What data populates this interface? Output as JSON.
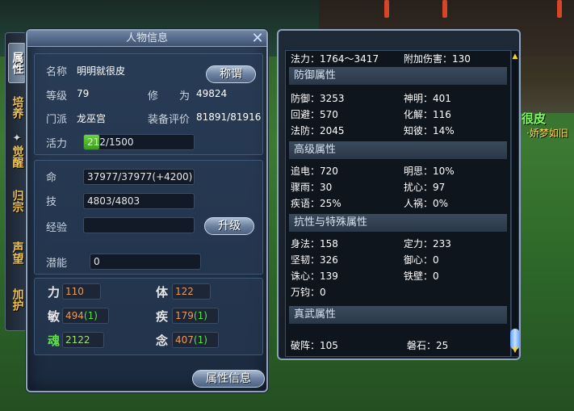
{
  "scene": {
    "player_name": "很皮",
    "player_title": "·娇梦如旧"
  },
  "side_tabs": [
    {
      "label": "属性"
    },
    {
      "label": "培养"
    },
    {
      "label": "觉醒"
    },
    {
      "label": "归宗"
    },
    {
      "label": "声望"
    },
    {
      "label": "加护"
    }
  ],
  "char_panel": {
    "title": "人物信息",
    "name_label": "名称",
    "name_value": "明明就很皮",
    "title_button": "称谓",
    "level_label": "等级",
    "level_value": "79",
    "cultivation_label": "修　　为",
    "cultivation_value": "49824",
    "sect_label": "门派",
    "sect_value": "龙巫宫",
    "equip_label": "装备评价",
    "equip_value": "81891/81916",
    "energy_label": "活力",
    "energy_value": "212/1500",
    "energy_fraction": 0.141,
    "hp_label": "命",
    "hp_value": "37977/37977(+4200)",
    "skill_label": "技",
    "skill_value": "4803/4803",
    "exp_label": "经验",
    "exp_value": "",
    "upgrade_button": "升级",
    "potential_label": "潜能",
    "potential_value": "0",
    "stats": {
      "str_label": "力",
      "str_value": "110",
      "con_label": "体",
      "con_value": "122",
      "agi_label": "敏",
      "agi_value": "494",
      "agi_bonus": "(1)",
      "spd_label": "疾",
      "spd_value": "179",
      "spd_bonus": "(1)",
      "soul_label": "魂",
      "soul_value": "2122",
      "mind_label": "念",
      "mind_value": "407",
      "mind_bonus": "(1)"
    },
    "attr_info_button": "属性信息"
  },
  "attr_panel": {
    "top_row": {
      "left": "法力：1764～3417",
      "right": "附加伤害：130"
    },
    "defense": {
      "title": "防御属性",
      "rows": [
        {
          "left": "防御：3253",
          "right": "神明：401"
        },
        {
          "left": "回避：570",
          "right": "化解：116"
        },
        {
          "left": "法防：2045",
          "right": "知彼：14%"
        }
      ]
    },
    "advanced": {
      "title": "高级属性",
      "rows": [
        {
          "left": "追电：720",
          "right": "明思：10%"
        },
        {
          "left": "骤雨：30",
          "right": "扰心：97"
        },
        {
          "left": "疾语：25%",
          "right": "人祸：0%"
        }
      ]
    },
    "resist": {
      "title": "抗性与特殊属性",
      "rows": [
        {
          "left": "身法：158",
          "right": "定力：233"
        },
        {
          "left": "坚韧：326",
          "right": "御心：0"
        },
        {
          "left": "诛心：139",
          "right": "铁壁：0"
        },
        {
          "left": "万钧：0",
          "right": ""
        }
      ]
    },
    "true_martial": {
      "title": "真武属性",
      "rows": [
        {
          "left": "破阵：105",
          "right": "磐石：25"
        }
      ]
    }
  }
}
